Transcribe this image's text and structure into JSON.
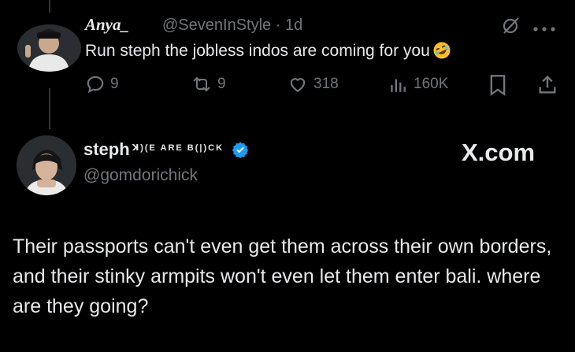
{
  "reply": {
    "display_name": "Anya_",
    "handle": "@SevenInStyle",
    "separator": "·",
    "age": "1d",
    "text": "Run steph the jobless indos are coming for you",
    "emoji": "rolling-on-floor-laughing",
    "metrics": {
      "replies": "9",
      "reposts": "9",
      "likes": "318",
      "views": "160K"
    }
  },
  "quoted": {
    "display_name": "steph",
    "name_decoration": "ꓘ)(E ARE B(|)CK",
    "verified": true,
    "handle": "@gomdorichick",
    "source_label": "X.com",
    "text": "Their passports can't even get them across their own borders, and their stinky armpits won't even let them enter bali. where are they going?"
  },
  "colors": {
    "background": "#000000",
    "primary_text": "#e7e9ea",
    "secondary_text": "#71767b",
    "verified_badge": "#1d9bf0",
    "thread_line": "#333639"
  },
  "icons": [
    "grok-icon",
    "more-icon",
    "reply-icon",
    "repost-icon",
    "like-icon",
    "views-icon",
    "bookmark-icon",
    "share-icon",
    "verified-badge-icon"
  ]
}
